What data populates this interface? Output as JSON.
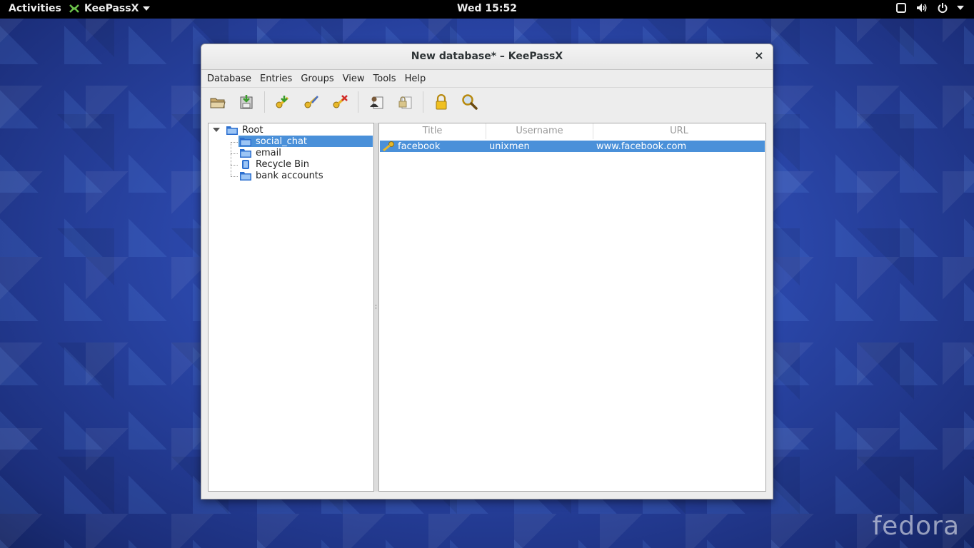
{
  "topbar": {
    "activities": "Activities",
    "app_name": "KeePassX",
    "clock": "Wed 15:52"
  },
  "branding": {
    "watermark": "fedora"
  },
  "window": {
    "title": "New database* – KeePassX",
    "close_glyph": "×"
  },
  "menu": [
    "Database",
    "Entries",
    "Groups",
    "View",
    "Tools",
    "Help"
  ],
  "toolbar_icons": [
    "open-database-icon",
    "save-database-icon",
    "add-entry-icon",
    "edit-entry-icon",
    "delete-entry-icon",
    "copy-username-icon",
    "copy-password-icon",
    "lock-icon",
    "search-icon"
  ],
  "groups": {
    "root": "Root",
    "items": [
      "social_chat",
      "email",
      "Recycle Bin",
      "bank accounts"
    ],
    "selected": "social_chat"
  },
  "entries": {
    "columns": [
      "Title",
      "Username",
      "URL"
    ],
    "rows": [
      {
        "title": "facebook",
        "username": "unixmen",
        "url": "www.facebook.com"
      }
    ]
  },
  "colors": {
    "selection": "#4a90d9",
    "folder": "#2c6fcf"
  }
}
